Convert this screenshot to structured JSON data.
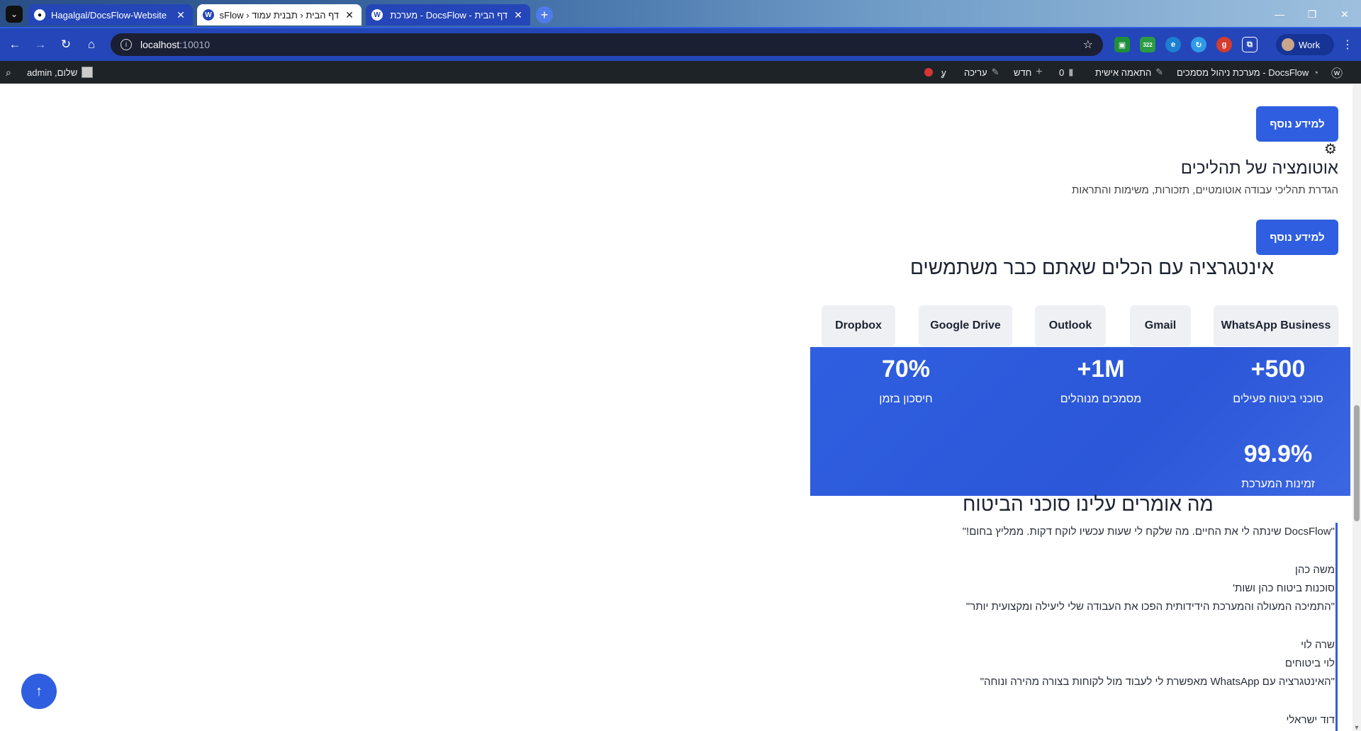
{
  "browser": {
    "tabs": [
      {
        "title": "Hagalgal/DocsFlow-Website",
        "icon": "github-icon",
        "active": false
      },
      {
        "title": "דף הבית ‹ תבנית עמוד ‹ DocsFlow",
        "icon": "wordpress-icon",
        "active": true
      },
      {
        "title": "דף הבית - DocsFlow - מערכת נ",
        "icon": "wordpress-icon",
        "active": false
      }
    ],
    "url_host": "localhost",
    "url_port": ":10010",
    "ext_badge": "322",
    "profile_label": "Work"
  },
  "adminbar": {
    "site_name": "DocsFlow - מערכת ניהול מסמכים",
    "customize": "התאמה אישית",
    "comments_count": "0",
    "new_label": "חדש",
    "edit_label": "עריכה",
    "greeting": "שלום, admin"
  },
  "page": {
    "more_button_1": "למידע נוסף",
    "more_button_2": "למידע נוסף",
    "feature_title": "אוטומציה של תהליכים",
    "feature_desc": "הגדרת תהליכי עבודה אוטומטיים, תזכורות, משימות והתראות",
    "integrations_title": "אינטגרציה עם הכלים שאתם כבר משתמשים",
    "integrations": [
      "WhatsApp Business",
      "Gmail",
      "Outlook",
      "Google Drive",
      "Dropbox"
    ],
    "stats": [
      {
        "value": "+500",
        "label": "סוכני ביטוח פעילים"
      },
      {
        "value": "+1M",
        "label": "מסמכים מנוהלים"
      },
      {
        "value": "70%",
        "label": "חיסכון בזמן"
      },
      {
        "value": "99.9%",
        "label": "זמינות המערכת"
      }
    ],
    "testimonials_title": "מה אומרים עלינו סוכני הביטוח",
    "testimonials": [
      {
        "quote": "\"DocsFlow שינתה לי את החיים. מה שלקח לי שעות עכשיו לוקח דקות. ממליץ בחום!\"",
        "name": "משה כהן",
        "company": "סוכנות ביטוח כהן ושות'"
      },
      {
        "quote": "\"התמיכה המעולה והמערכת הידידותית הפכו את העבודה שלי ליעילה ומקצועית יותר\"",
        "name": "שרה לוי",
        "company": "לוי ביטוחים"
      },
      {
        "quote": "\"האינטגרציה עם WhatsApp מאפשרת לי לעבוד מול לקוחות בצורה מהירה ונוחה\"",
        "name": "דוד ישראלי",
        "company": ""
      }
    ],
    "scroll_top_label": "↑"
  }
}
